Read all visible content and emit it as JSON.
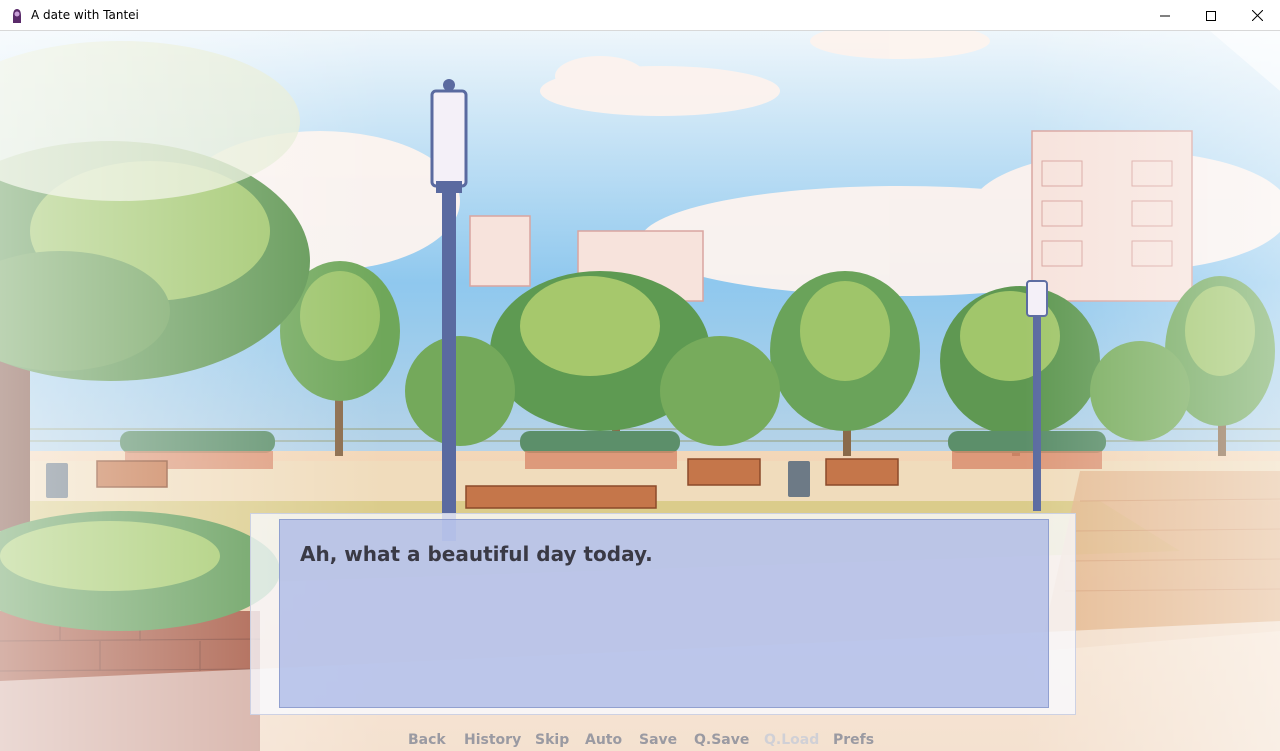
{
  "window": {
    "title": "A date with Tantei",
    "icons": [
      "app-icon",
      "minimize-icon",
      "maximize-icon",
      "close-icon"
    ]
  },
  "dialogue": {
    "text": "Ah, what a beautiful day today."
  },
  "quick_menu": {
    "items": [
      {
        "label": "Back",
        "enabled": true
      },
      {
        "label": "History",
        "enabled": true
      },
      {
        "label": "Skip",
        "enabled": true
      },
      {
        "label": "Auto",
        "enabled": true
      },
      {
        "label": "Save",
        "enabled": true
      },
      {
        "label": "Q.Save",
        "enabled": true
      },
      {
        "label": "Q.Load",
        "enabled": false
      },
      {
        "label": "Prefs",
        "enabled": true
      }
    ]
  },
  "colors": {
    "sky": "#a9d3ef",
    "foliage": "#7ab45a",
    "path": "#e9c9a6",
    "dialogue_box": "#a5b4e6",
    "menu_text": "#9a9aa2"
  }
}
